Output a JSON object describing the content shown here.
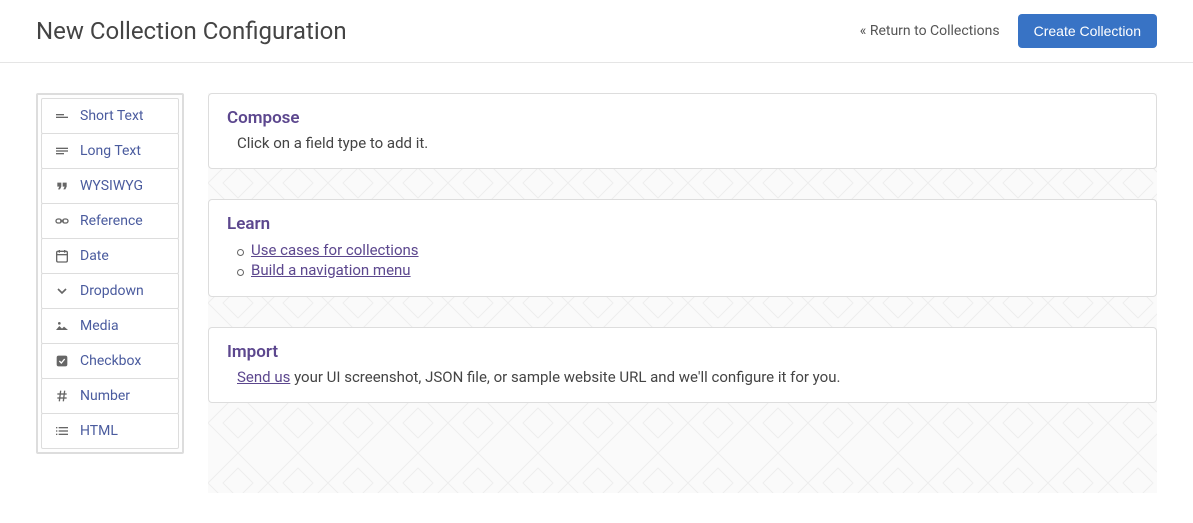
{
  "header": {
    "title": "New Collection Configuration",
    "return_link": "« Return to Collections",
    "create_button": "Create Collection"
  },
  "sidebar": {
    "items": [
      {
        "label": "Short Text",
        "icon": "short-text"
      },
      {
        "label": "Long Text",
        "icon": "long-text"
      },
      {
        "label": "WYSIWYG",
        "icon": "quote"
      },
      {
        "label": "Reference",
        "icon": "link"
      },
      {
        "label": "Date",
        "icon": "calendar"
      },
      {
        "label": "Dropdown",
        "icon": "chevron-down"
      },
      {
        "label": "Media",
        "icon": "image"
      },
      {
        "label": "Checkbox",
        "icon": "checkbox"
      },
      {
        "label": "Number",
        "icon": "hash"
      },
      {
        "label": "HTML",
        "icon": "list"
      }
    ]
  },
  "compose": {
    "title": "Compose",
    "text": "Click on a field type to add it."
  },
  "learn": {
    "title": "Learn",
    "links": [
      "Use cases for collections",
      "Build a navigation menu"
    ]
  },
  "import": {
    "title": "Import",
    "link_text": "Send us",
    "rest_text": " your UI screenshot, JSON file, or sample website URL and we'll configure it for you."
  }
}
